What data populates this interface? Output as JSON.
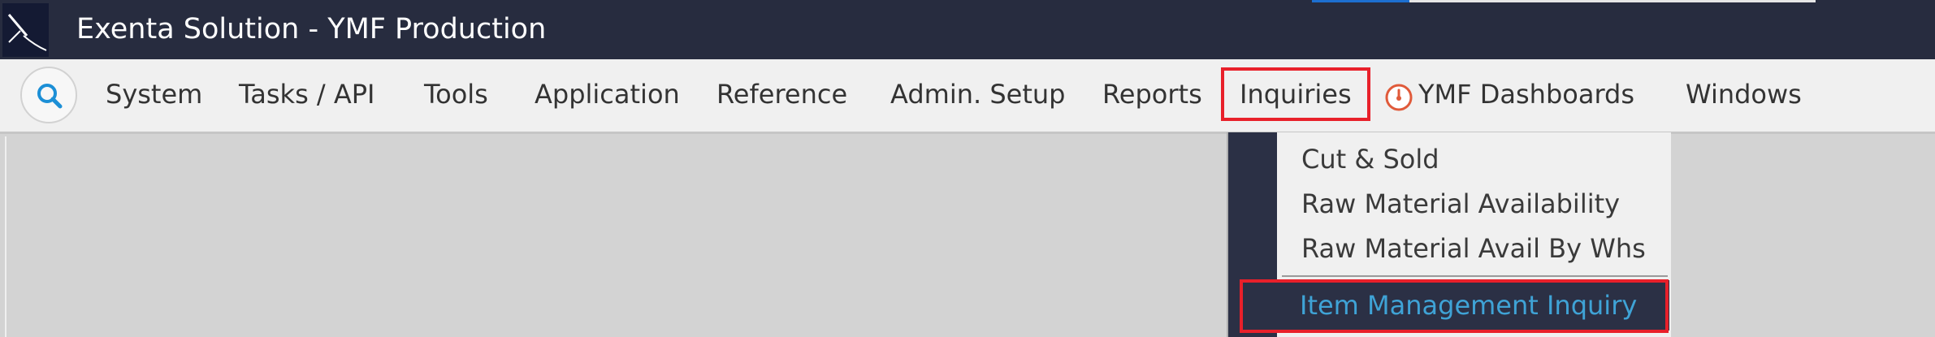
{
  "window": {
    "title": "Exenta Solution - YMF Production",
    "logo_icon": "exenta-logo-icon"
  },
  "menubar": {
    "search_icon": "search-icon",
    "items": [
      {
        "label": "System"
      },
      {
        "label": "Tasks / API"
      },
      {
        "label": "Tools"
      },
      {
        "label": "Application"
      },
      {
        "label": "Reference"
      },
      {
        "label": "Admin. Setup"
      },
      {
        "label": "Reports"
      },
      {
        "label": "Inquiries"
      },
      {
        "label": "YMF Dashboards",
        "icon": "gauge-icon"
      },
      {
        "label": "Windows"
      }
    ],
    "active_item": "Inquiries"
  },
  "inquiries_menu": {
    "items": [
      {
        "label": "Cut & Sold"
      },
      {
        "label": "Raw Material Availability"
      },
      {
        "label": "Raw Material Avail By Whs"
      },
      {
        "label": "Item Management Inquiry"
      }
    ],
    "selected": "Item Management Inquiry"
  },
  "colors": {
    "titlebar_bg": "#272c3f",
    "menubar_bg": "#f0f0f0",
    "content_bg": "#d3d3d3",
    "menu_highlight_bg": "#2b3045",
    "menu_highlight_text": "#3fa3d6",
    "annotation_red": "#e8202a"
  }
}
